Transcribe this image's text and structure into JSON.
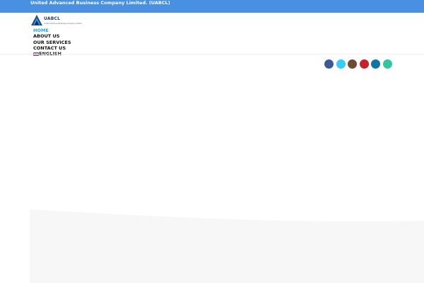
{
  "topbar": {
    "text": "United Advanced Business Company Limited. (UABCL)",
    "color": "#4a90e2"
  },
  "logo": {
    "text": "UABCL",
    "subtext": "United Advanced Business Company Limited"
  },
  "nav": {
    "items": [
      {
        "label": "HOME",
        "active": true
      },
      {
        "label": "ABOUT US",
        "active": false
      },
      {
        "label": "OUR SERVICES",
        "active": false
      },
      {
        "label": "CONTACT US",
        "active": false
      },
      {
        "label": "ENGLISH",
        "active": false,
        "icon": "uk-flag-icon"
      }
    ],
    "active_color": "#29a9e1"
  },
  "social": [
    {
      "icon": "facebook-icon",
      "color": "#3b5998"
    },
    {
      "icon": "twitter-icon",
      "color": "#33ccff"
    },
    {
      "icon": "instagram-icon",
      "color": "#6f4a36"
    },
    {
      "icon": "pinterest-icon",
      "color": "#cb2027"
    },
    {
      "icon": "linkedin-icon",
      "color": "#0e76a8"
    },
    {
      "icon": "tripadvisor-icon",
      "color": "#2ec7a0"
    }
  ]
}
